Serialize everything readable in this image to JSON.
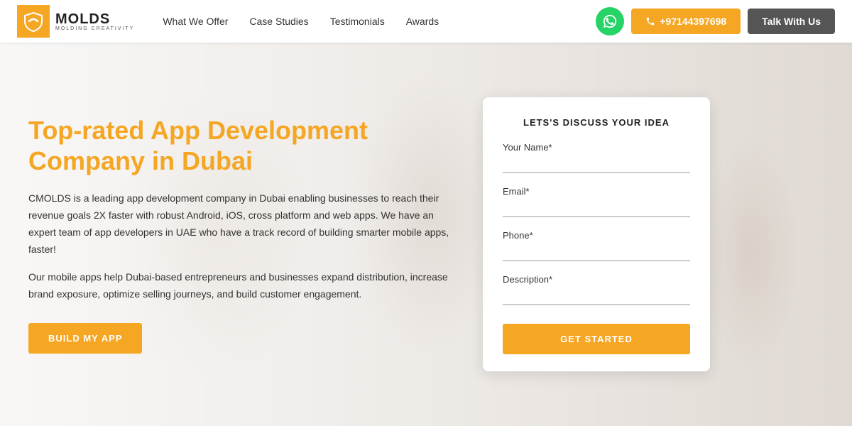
{
  "navbar": {
    "logo_brand": "MOLDS",
    "logo_sub": "MOLDING CREATIVITY",
    "nav_links": [
      {
        "label": "What We Offer",
        "id": "what-we-offer"
      },
      {
        "label": "Case Studies",
        "id": "case-studies"
      },
      {
        "label": "Testimonials",
        "id": "testimonials"
      },
      {
        "label": "Awards",
        "id": "awards"
      }
    ],
    "phone_number": "+97144397698",
    "talk_btn_label": "Talk With Us"
  },
  "hero": {
    "title": "Top-rated App Development Company in Dubai",
    "description1": "CMOLDS is a leading app development company in Dubai enabling businesses to reach their revenue goals 2X faster with robust Android, iOS, cross platform and web apps. We have an expert team of app developers in UAE who have a track record of building smarter mobile apps, faster!",
    "description2": "Our mobile apps help Dubai-based entrepreneurs and businesses expand distribution, increase brand exposure, optimize selling journeys, and build customer engagement.",
    "cta_label": "BUILD MY APP"
  },
  "form": {
    "title": "LETS'S DISCUSS YOUR IDEA",
    "fields": [
      {
        "label": "Your Name*",
        "id": "name",
        "placeholder": ""
      },
      {
        "label": "Email*",
        "id": "email",
        "placeholder": ""
      },
      {
        "label": "Phone*",
        "id": "phone",
        "placeholder": ""
      },
      {
        "label": "Description*",
        "id": "description",
        "placeholder": ""
      }
    ],
    "submit_label": "GET STARTED"
  },
  "colors": {
    "orange": "#f5a623",
    "dark": "#333",
    "whatsapp": "#25D366",
    "talk_btn": "#555555"
  }
}
